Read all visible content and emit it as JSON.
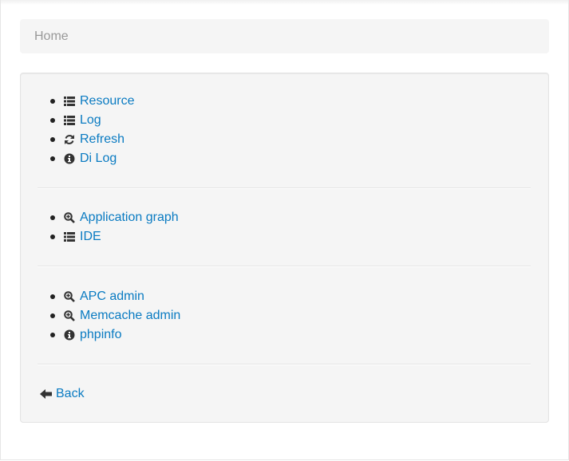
{
  "breadcrumb": {
    "home": "Home"
  },
  "groups": [
    {
      "items": [
        {
          "label": "Resource",
          "icon": "list-icon"
        },
        {
          "label": "Log",
          "icon": "list-icon"
        },
        {
          "label": "Refresh",
          "icon": "refresh-icon"
        },
        {
          "label": "Di Log",
          "icon": "info-icon"
        }
      ]
    },
    {
      "items": [
        {
          "label": "Application graph",
          "icon": "zoom-in-icon"
        },
        {
          "label": "IDE",
          "icon": "list-icon"
        }
      ]
    },
    {
      "items": [
        {
          "label": "APC admin",
          "icon": "zoom-in-icon"
        },
        {
          "label": "Memcache admin",
          "icon": "zoom-in-icon"
        },
        {
          "label": "phpinfo",
          "icon": "info-icon"
        }
      ]
    }
  ],
  "back": {
    "label": "Back",
    "icon": "arrow-left-icon"
  },
  "colors": {
    "link": "#0a7bc2",
    "well_bg": "#f5f5f5",
    "breadcrumb_text": "#999999"
  }
}
